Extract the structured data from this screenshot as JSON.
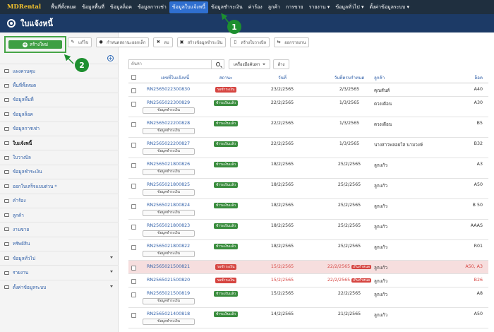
{
  "brand": "MDRental",
  "nav": [
    {
      "label": "พื้นที่ทั้งหมด"
    },
    {
      "label": "ข้อมูลพื้นที่"
    },
    {
      "label": "ข้อมูลล็อค"
    },
    {
      "label": "ข้อมูลการเช่า"
    },
    {
      "label": "ข้อมูลใบแจ้งหนี้",
      "active": true
    },
    {
      "label": "ข้อมูลชำระเงิน"
    },
    {
      "label": "ค่าร้อง"
    },
    {
      "label": "ลูกค้า"
    },
    {
      "label": "การขาย"
    },
    {
      "label": "รายงาน ▾"
    },
    {
      "label": "ข้อมูลทั่วไป ▾"
    },
    {
      "label": "ตั้งค่าข้อมูลระบบ ▾"
    }
  ],
  "page_title": "ใบแจ้งหนี้",
  "create_label": "สร้างใหม่",
  "toolbar": {
    "edit": "แก้ไข",
    "set_status": "กำหนดสถานะออกเล็ก",
    "delete": "ลบ",
    "create_payment": "สร้างข้อมูลชำระเงิน",
    "create_receipt": "สร้างใบวางบิล",
    "export": "ออกรายงาน"
  },
  "sidebar": [
    {
      "label": "แผงควบคุม"
    },
    {
      "label": "พื้นที่ทั้งหมด"
    },
    {
      "label": "ข้อมูลพื้นที่"
    },
    {
      "label": "ข้อมูลล็อค"
    },
    {
      "label": "ข้อมูลการเช่า"
    },
    {
      "label": "ใบแจ้งหนี้",
      "active": true
    },
    {
      "label": "ใบวางบิล"
    },
    {
      "label": "ข้อมูลชำระเงิน"
    },
    {
      "label": "ออกใบเสร็จแบบด่วน *"
    },
    {
      "label": "คำร้อง"
    },
    {
      "label": "ลูกค้า"
    },
    {
      "label": "งานขาย"
    },
    {
      "label": "ทรัพย์สิน"
    },
    {
      "label": "ข้อมูลทั่วไป",
      "caret": true
    },
    {
      "label": "รายงาน",
      "caret": true
    },
    {
      "label": "ตั้งค่าข้อมูลระบบ",
      "caret": true
    }
  ],
  "search": {
    "placeholder": "ค้นหา",
    "tools": "เครื่องมือค้นหา",
    "clear": "ล้าง"
  },
  "columns": {
    "invoice": "เลขที่ใบแจ้งหนี้",
    "status": "สถานะ",
    "date": "วันที่",
    "due": "วันที่ครบกำหนด",
    "customer": "ลูกค้า",
    "room": "ล็อค"
  },
  "pay_label": "ข้อมูลชำระเงิน",
  "overdue_label": "เกินกำหนด",
  "rows": [
    {
      "invoice": "RN2565022300830",
      "status": "รอชำระเงิน",
      "status_color": "red",
      "date": "23/2/2565",
      "due": "2/3/2565",
      "customer": "คุณสันต์",
      "room": "A40",
      "pay": false
    },
    {
      "invoice": "RN2565022300829",
      "status": "ชำระเงินแล้ว",
      "status_color": "green",
      "date": "22/2/2565",
      "due": "1/3/2565",
      "customer": "ดวงเดือน",
      "room": "A30",
      "pay": true
    },
    {
      "invoice": "RN2565022200828",
      "status": "ชำระเงินแล้ว",
      "status_color": "green",
      "date": "22/2/2565",
      "due": "1/3/2565",
      "customer": "ดวงเดือน",
      "room": "B5",
      "pay": true
    },
    {
      "invoice": "RN2565022200827",
      "status": "ชำระเงินแล้ว",
      "status_color": "green",
      "date": "22/2/2565",
      "due": "1/3/2565",
      "customer": "นางสาวพลอยใส นามวงษ์",
      "room": "B32",
      "pay": true
    },
    {
      "invoice": "RN2565021800826",
      "status": "ชำระเงินแล้ว",
      "status_color": "green",
      "date": "18/2/2565",
      "due": "25/2/2565",
      "customer": "ลูกแก้ว",
      "room": "A3",
      "pay": true
    },
    {
      "invoice": "RN2565021800825",
      "status": "ชำระเงินแล้ว",
      "status_color": "green",
      "date": "18/2/2565",
      "due": "25/2/2565",
      "customer": "ลูกแก้ว",
      "room": "A50",
      "pay": true
    },
    {
      "invoice": "RN2565021800824",
      "status": "ชำระเงินแล้ว",
      "status_color": "green",
      "date": "18/2/2565",
      "due": "25/2/2565",
      "customer": "ลูกแก้ว",
      "room": "B 50",
      "pay": true
    },
    {
      "invoice": "RN2565021800823",
      "status": "ชำระเงินแล้ว",
      "status_color": "green",
      "date": "18/2/2565",
      "due": "25/2/2565",
      "customer": "ลูกแก้ว",
      "room": "AAAS",
      "pay": true
    },
    {
      "invoice": "RN2565021800822",
      "status": "ชำระเงินแล้ว",
      "status_color": "green",
      "date": "18/2/2565",
      "due": "25/2/2565",
      "customer": "ลูกแก้ว",
      "room": "R01",
      "pay": true
    },
    {
      "invoice": "RN2565021500821",
      "status": "รอชำระเงิน",
      "status_color": "red",
      "date": "15/2/2565",
      "due": "22/2/2565",
      "overdue": true,
      "customer": "ลูกแก้ว",
      "room": "A50, A3",
      "pay": false,
      "highlight": true
    },
    {
      "invoice": "RN2565021500820",
      "status": "รอชำระเงิน",
      "status_color": "red",
      "date": "15/2/2565",
      "due": "22/2/2565",
      "overdue": true,
      "customer": "ลูกแก้ว",
      "room": "B26",
      "pay": false
    },
    {
      "invoice": "RN2565021500819",
      "status": "ชำระเงินแล้ว",
      "status_color": "green",
      "date": "15/2/2565",
      "due": "22/2/2565",
      "customer": "ลูกแก้ว",
      "room": "A8",
      "pay": true
    },
    {
      "invoice": "RN2565021400818",
      "status": "ชำระเงินแล้ว",
      "status_color": "green",
      "date": "14/2/2565",
      "due": "21/2/2565",
      "customer": "ลูกแก้ว",
      "room": "A50",
      "pay": true
    }
  ],
  "annotations": {
    "one": "1",
    "two": "2"
  },
  "colors": {
    "nav_bg": "#1f2f3f",
    "title_bg": "#1c3a66",
    "accent_green": "#3e9f44",
    "danger": "#d64541",
    "link": "#2f5fa8"
  }
}
